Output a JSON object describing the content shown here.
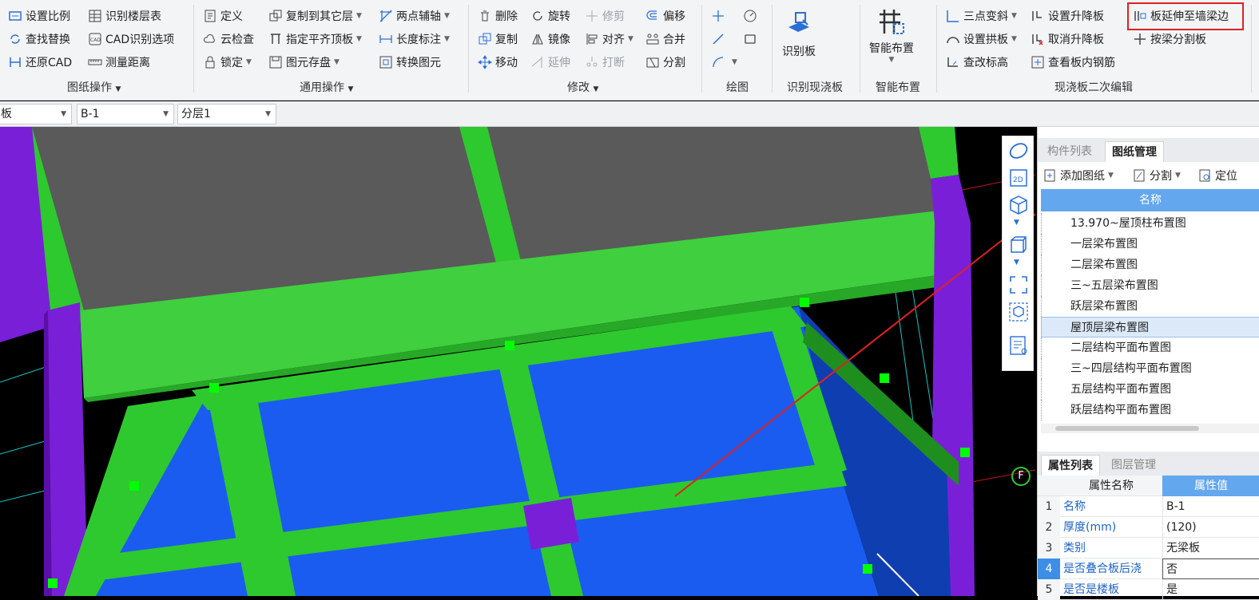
{
  "ribbon": {
    "groups": {
      "drawing_ops": {
        "label": "图纸操作",
        "items": [
          "设置比例",
          "识别楼层表",
          "查找替换",
          "CAD识别选项",
          "还原CAD",
          "测量距离"
        ]
      },
      "common_ops": {
        "label": "通用操作",
        "items": [
          "定义",
          "复制到其它层",
          "两点辅轴",
          "云检查",
          "指定平齐顶板",
          "长度标注",
          "锁定",
          "图元存盘",
          "转换图元"
        ]
      },
      "modify": {
        "label": "修改",
        "items": [
          "删除",
          "旋转",
          "修剪",
          "偏移",
          "复制",
          "镜像",
          "对齐",
          "合并",
          "移动",
          "延伸",
          "打断",
          "分割"
        ]
      },
      "draw": {
        "label": "绘图"
      },
      "recognize": {
        "label": "识别现浇板",
        "big_button": "识别板"
      },
      "smart": {
        "label": "智能布置",
        "big_button": "智能布置"
      },
      "secondary_edit": {
        "label": "现浇板二次编辑",
        "items": [
          "三点变斜",
          "设置升降板",
          "板延伸至墙梁边",
          "设置拱板",
          "取消升降板",
          "按梁分割板",
          "查改标高",
          "查看板内钢筋"
        ]
      }
    }
  },
  "toolbar2": {
    "combo1": "板",
    "combo2": "B-1",
    "combo3": "分层1"
  },
  "viewport": {
    "axis_badge": "F"
  },
  "panel_top": {
    "tabs": [
      "构件列表",
      "图纸管理"
    ],
    "actions": {
      "add": "添加图纸",
      "split": "分割",
      "locate": "定位"
    },
    "column_header": "名称",
    "rows": [
      "13.970~屋顶柱布置图",
      "一层梁布置图",
      "二层梁布置图",
      "三~五层梁布置图",
      "跃层梁布置图",
      "屋顶层梁布置图",
      "二层结构平面布置图",
      "三~四层结构平面布置图",
      "五层结构平面布置图",
      "跃层结构平面布置图"
    ],
    "selected_index": 5
  },
  "panel_bottom": {
    "tabs": [
      "属性列表",
      "图层管理"
    ],
    "headers": {
      "name": "属性名称",
      "value": "属性值"
    },
    "rows": [
      {
        "n": "1",
        "k": "名称",
        "v": "B-1"
      },
      {
        "n": "2",
        "k": "厚度(mm)",
        "v": "(120)"
      },
      {
        "n": "3",
        "k": "类别",
        "v": "无梁板"
      },
      {
        "n": "4",
        "k": "是否叠合板后浇",
        "v": "否"
      },
      {
        "n": "5",
        "k": "是否是楼板",
        "v": "是"
      }
    ]
  },
  "colors": {
    "slab_blue": "#1a5cf0",
    "beam_green": "#2ec92e",
    "column_purple": "#7a1fd8",
    "roof_gray": "#5a5a5a",
    "annotation_red": "#e02020",
    "header_blue": "#63a7ee"
  }
}
